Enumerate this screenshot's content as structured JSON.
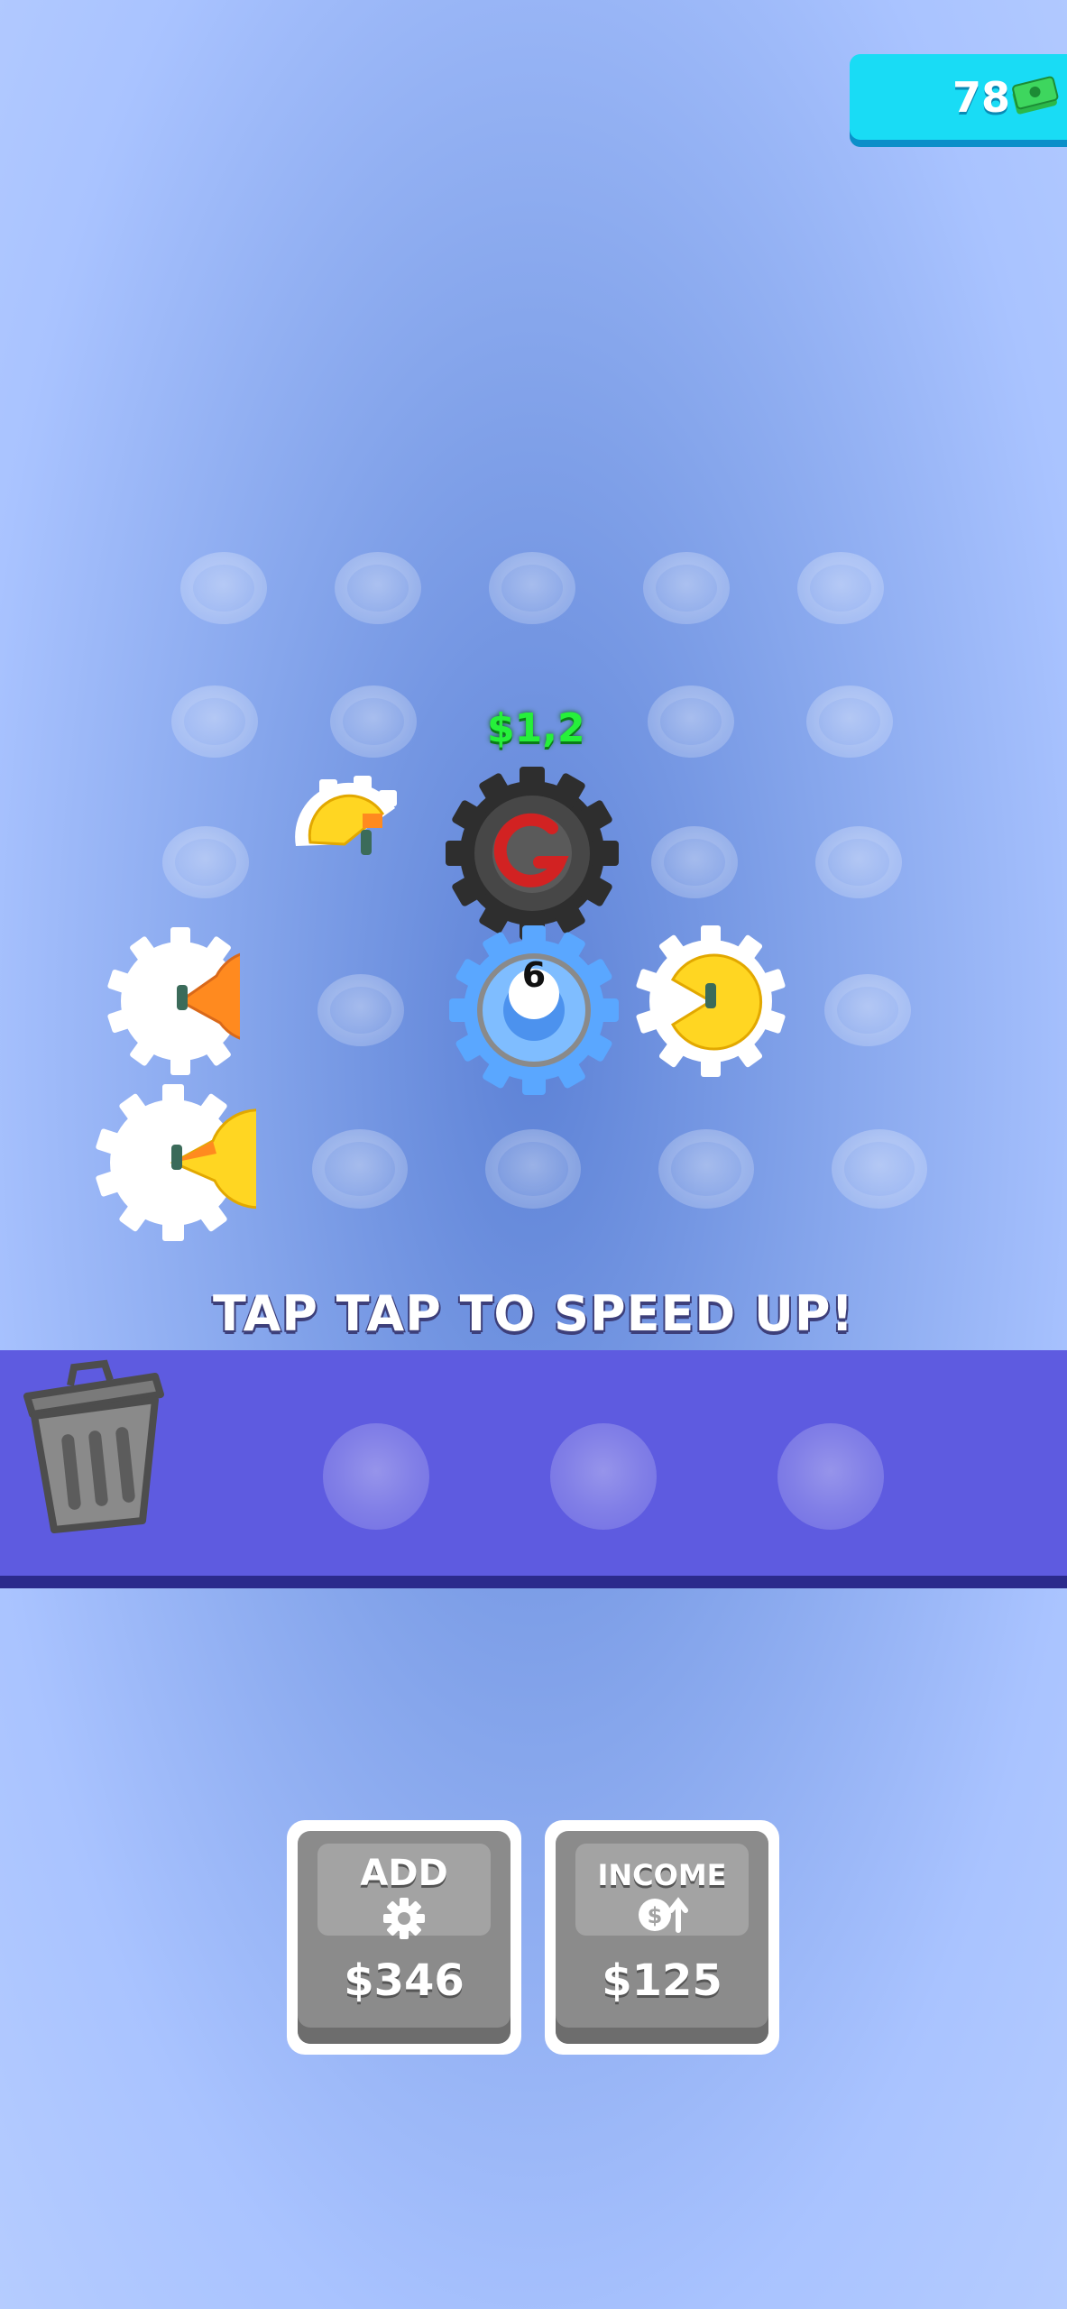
{
  "hud": {
    "money": "78",
    "money_icon": "cash-stack-icon"
  },
  "board": {
    "gear_price": "$1,2",
    "center_gear_level": "6"
  },
  "hint": "TAP TAP TO SPEED UP!",
  "tray": {
    "trash_icon": "trash-can-icon"
  },
  "buttons": {
    "add": {
      "label": "ADD",
      "icon": "gear-icon",
      "price": "$346"
    },
    "income": {
      "label": "INCOME",
      "icon": "coin-up-icon",
      "price": "$125"
    }
  },
  "colors": {
    "accent_cyan": "#19dcf5",
    "tray_purple": "#5e5be0",
    "price_green": "#26f03a",
    "gear_blue": "#5aa7ff",
    "gear_yellow": "#ffd622",
    "gear_orange": "#ff8a1f",
    "gear_dark": "#3c3c3c"
  }
}
